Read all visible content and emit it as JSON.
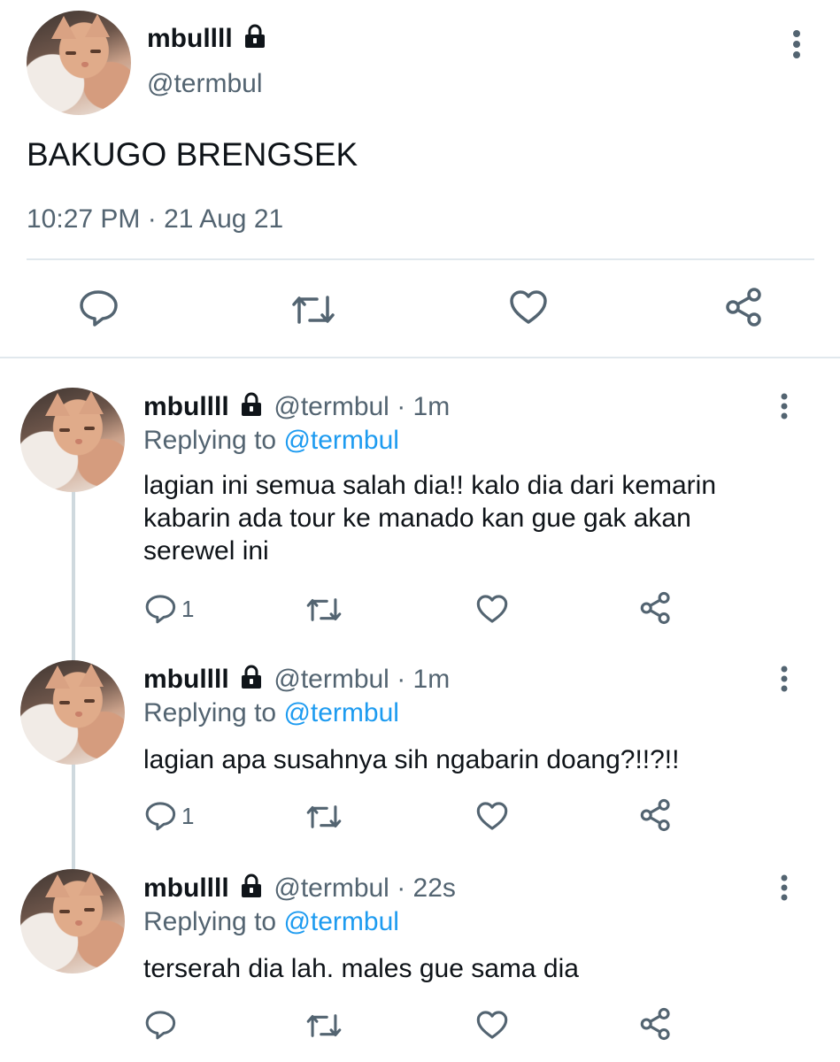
{
  "main_tweet": {
    "display_name": "mbullll",
    "handle": "@termbul",
    "text": "BAKUGO BRENGSEK",
    "timestamp": "10:27 PM · 21 Aug 21"
  },
  "replies": [
    {
      "display_name": "mbullll",
      "handle": "@termbul",
      "time": "· 1m",
      "replying_label": "Replying to",
      "replying_handle": "@termbul",
      "text_lines": [
        "lagian ini semua salah dia!! kalo dia dari kemarin",
        "kabarin ada tour ke manado kan gue gak akan",
        "serewel ini"
      ],
      "reply_count": "1"
    },
    {
      "display_name": "mbullll",
      "handle": "@termbul",
      "time": "· 1m",
      "replying_label": "Replying to",
      "replying_handle": "@termbul",
      "text_lines": [
        "lagian apa susahnya sih ngabarin doang?!!?!!"
      ],
      "reply_count": "1"
    },
    {
      "display_name": "mbullll",
      "handle": "@termbul",
      "time": "· 22s",
      "replying_label": "Replying to",
      "replying_handle": "@termbul",
      "text_lines": [
        "terserah dia lah. males gue sama dia"
      ],
      "reply_count": ""
    }
  ],
  "icons": {
    "lock": "lock-icon",
    "more": "more-vertical-icon",
    "reply": "reply-icon",
    "retweet": "retweet-icon",
    "like": "heart-icon",
    "share": "share-icon"
  },
  "colors": {
    "text": "#0f1419",
    "muted": "#536471",
    "link": "#1d9bf0",
    "divider": "#e1e8ed"
  }
}
